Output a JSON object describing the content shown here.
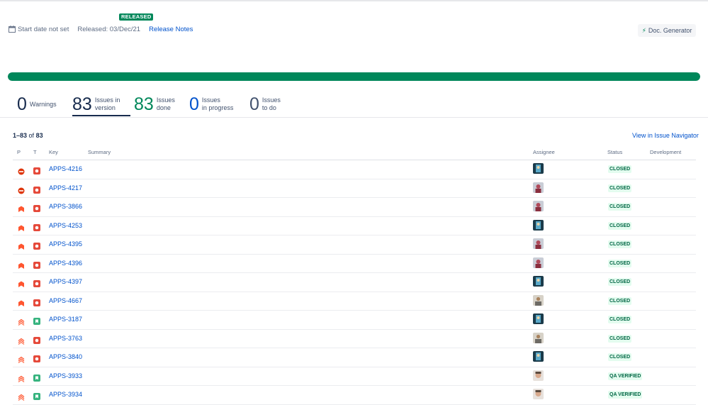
{
  "header": {
    "release_badge": "RELEASED",
    "start_date": "Start date not set",
    "released": "Released: 03/Dec/21",
    "release_notes": "Release Notes",
    "doc_button": "Doc. Generator"
  },
  "progress": {
    "done_fraction": 1.0,
    "color": "#00875a"
  },
  "stats": [
    {
      "num": "0",
      "label": "Warnings",
      "color": "#172b4d"
    },
    {
      "num": "83",
      "label": "Issues in\nversion",
      "color": "#172b4d"
    },
    {
      "num": "83",
      "label": "Issues\ndone",
      "color": "#00875a"
    },
    {
      "num": "0",
      "label": "Issues\nin progress",
      "color": "#0052cc"
    },
    {
      "num": "0",
      "label": "Issues\nto do",
      "color": "#42526e"
    }
  ],
  "list": {
    "range": "1–83",
    "of": "of",
    "total": "83",
    "navigator_link": "View in Issue Navigator",
    "columns": {
      "p": "P",
      "t": "T",
      "key": "Key",
      "summary": "Summary",
      "assignee": "Assignee",
      "status": "Status",
      "development": "Development"
    },
    "rows": [
      {
        "priority": "blocker",
        "type": "bug",
        "key": "APPS-4216",
        "avatar": "a",
        "status": "CLOSED"
      },
      {
        "priority": "blocker",
        "type": "bug",
        "key": "APPS-4217",
        "avatar": "b",
        "status": "CLOSED"
      },
      {
        "priority": "highest",
        "type": "bug",
        "key": "APPS-3866",
        "avatar": "b",
        "status": "CLOSED"
      },
      {
        "priority": "highest",
        "type": "bug",
        "key": "APPS-4253",
        "avatar": "a",
        "status": "CLOSED"
      },
      {
        "priority": "highest",
        "type": "bug",
        "key": "APPS-4395",
        "avatar": "b",
        "status": "CLOSED"
      },
      {
        "priority": "highest",
        "type": "bug",
        "key": "APPS-4396",
        "avatar": "b",
        "status": "CLOSED"
      },
      {
        "priority": "highest",
        "type": "bug",
        "key": "APPS-4397",
        "avatar": "a",
        "status": "CLOSED"
      },
      {
        "priority": "highest",
        "type": "bug",
        "key": "APPS-4667",
        "avatar": "c",
        "status": "CLOSED"
      },
      {
        "priority": "high",
        "type": "story",
        "key": "APPS-3187",
        "avatar": "a",
        "status": "CLOSED"
      },
      {
        "priority": "high",
        "type": "bug",
        "key": "APPS-3763",
        "avatar": "c",
        "status": "CLOSED"
      },
      {
        "priority": "high",
        "type": "bug",
        "key": "APPS-3840",
        "avatar": "a",
        "status": "CLOSED"
      },
      {
        "priority": "high",
        "type": "story",
        "key": "APPS-3933",
        "avatar": "d",
        "status": "QA VERIFIED"
      },
      {
        "priority": "high",
        "type": "story",
        "key": "APPS-3934",
        "avatar": "d",
        "status": "QA VERIFIED"
      }
    ]
  }
}
